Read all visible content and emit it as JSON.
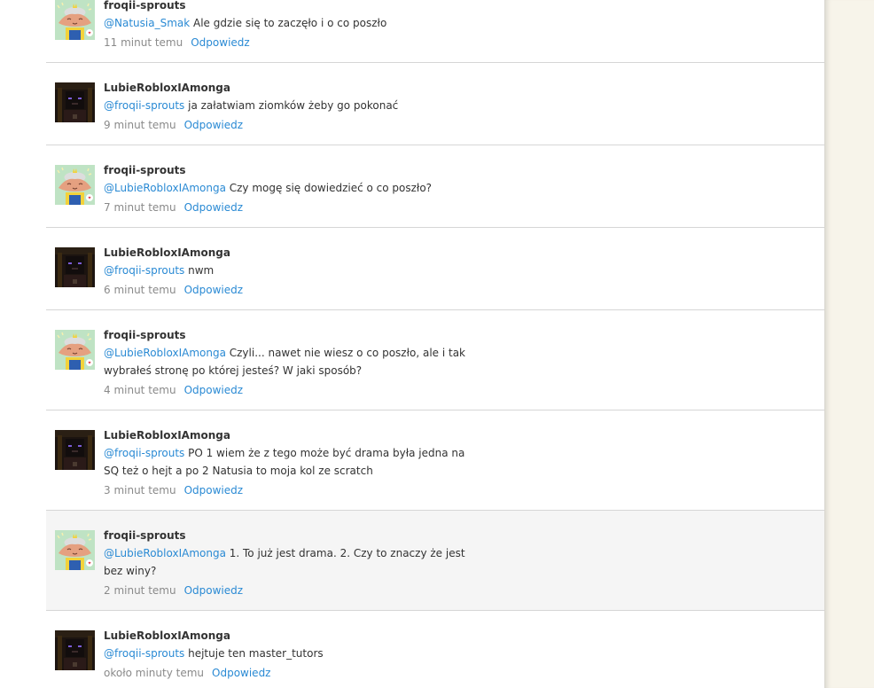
{
  "comments": [
    {
      "author": "froqii-sprouts",
      "mention": "@Natusia_Smak",
      "text": " Ale gdzie się to zaczęło i o co poszło",
      "time": "11 minut temu",
      "reply": "Odpowiedz",
      "avatar": "frog-avatar"
    },
    {
      "author": "LubieRobloxIAmonga",
      "mention": "@froqii-sprouts",
      "text": " ja załatwiam ziomków żeby go pokonać",
      "time": "9 minut temu",
      "reply": "Odpowiedz",
      "avatar": "dark-avatar"
    },
    {
      "author": "froqii-sprouts",
      "mention": "@LubieRobloxIAmonga",
      "text": " Czy mogę się dowiedzieć o co poszło?",
      "time": "7 minut temu",
      "reply": "Odpowiedz",
      "avatar": "frog-avatar"
    },
    {
      "author": "LubieRobloxIAmonga",
      "mention": "@froqii-sprouts",
      "text": " nwm",
      "time": "6 minut temu",
      "reply": "Odpowiedz",
      "avatar": "dark-avatar"
    },
    {
      "author": "froqii-sprouts",
      "mention": "@LubieRobloxIAmonga",
      "text": " Czyli... nawet nie wiesz o co poszło, ale i tak wybrałeś stronę po której jesteś? W jaki sposób?",
      "time": "4 minut temu",
      "reply": "Odpowiedz",
      "avatar": "frog-avatar"
    },
    {
      "author": "LubieRobloxIAmonga",
      "mention": "@froqii-sprouts",
      "text": " PO 1 wiem że z tego może być drama była jedna na SQ też o hejt a po 2 Natusia to moja kol ze scratch",
      "time": "3 minut temu",
      "reply": "Odpowiedz",
      "avatar": "dark-avatar"
    },
    {
      "author": "froqii-sprouts",
      "mention": "@LubieRobloxIAmonga",
      "text": " 1. To już jest drama. 2. Czy to znaczy że jest bez winy?",
      "time": "2 minut temu",
      "reply": "Odpowiedz",
      "avatar": "frog-avatar",
      "highlight": true
    },
    {
      "author": "LubieRobloxIAmonga",
      "mention": "@froqii-sprouts",
      "text": " hejtuje ten master_tutors",
      "time": "około minuty temu",
      "reply": "Odpowiedz",
      "avatar": "dark-avatar"
    }
  ]
}
